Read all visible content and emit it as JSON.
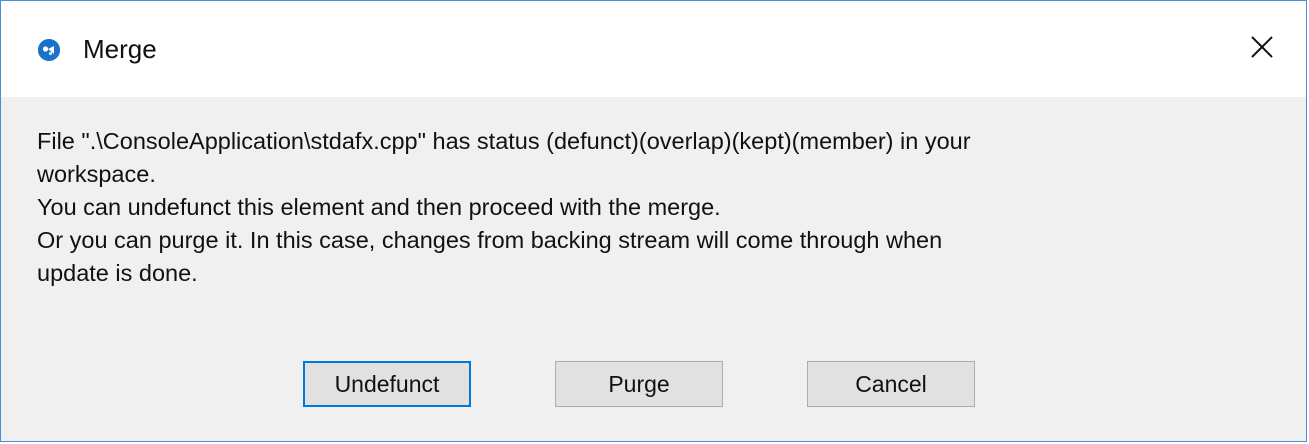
{
  "window": {
    "title": "Merge",
    "icon": "merge-app-icon",
    "close_glyph": "✕"
  },
  "message": {
    "line1": "File \".\\ConsoleApplication\\stdafx.cpp\" has status (defunct)(overlap)(kept)(member) in your",
    "line2": "workspace.",
    "line3": "You can undefunct this element and then proceed with the merge.",
    "line4": "Or you can purge it. In this case, changes from backing stream will come through when",
    "line5": "update is done."
  },
  "buttons": {
    "undefunct_label": "Undefunct",
    "purge_label": "Purge",
    "cancel_label": "Cancel"
  },
  "colors": {
    "accent": "#0078d7",
    "icon": "#1a73c8",
    "background": "#f0f0f0",
    "titlebar": "#ffffff"
  }
}
